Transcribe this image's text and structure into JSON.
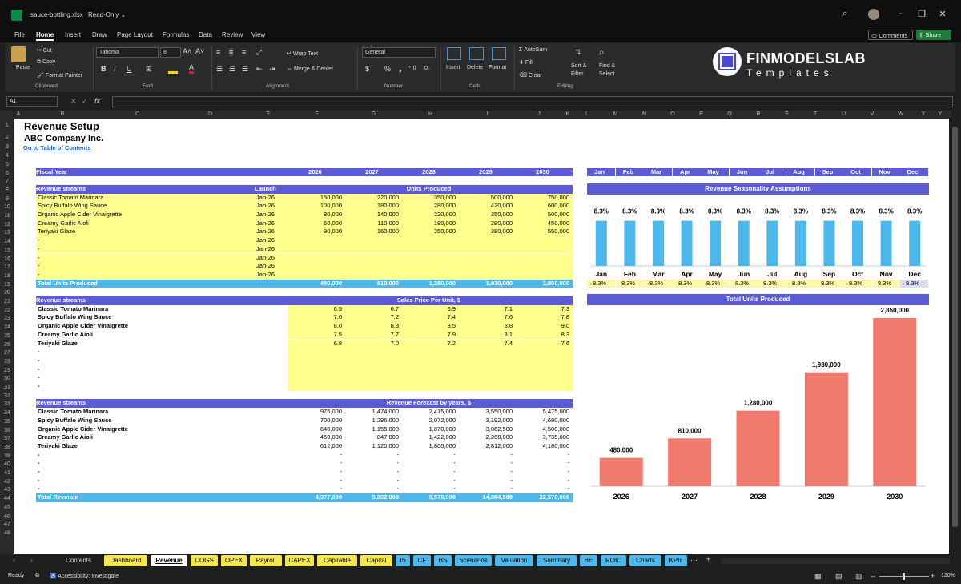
{
  "window": {
    "filename": "sauce-bottling.xlsx",
    "mode": "Read-Only ⌄"
  },
  "menu": [
    "File",
    "Home",
    "Insert",
    "Draw",
    "Page Layout",
    "Formulas",
    "Data",
    "Review",
    "View"
  ],
  "menu_right": {
    "comments": "Comments",
    "share": "Share"
  },
  "ribbon": {
    "clipboard": {
      "paste": "Paste",
      "cut": "Cut",
      "copy": "Copy",
      "format_painter": "Format Painter",
      "label": "Clipboard"
    },
    "font": {
      "name": "Tahoma",
      "size": "8",
      "label": "Font",
      "bold": "B",
      "italic": "I",
      "underline": "U"
    },
    "alignment": {
      "wrap": "Wrap Text",
      "merge": "Merge & Center",
      "label": "Alignment"
    },
    "number": {
      "format": "General",
      "label": "Number"
    },
    "cells": {
      "insert": "Insert",
      "delete": "Delete",
      "format": "Format",
      "label": "Cells"
    },
    "editing": {
      "autosum": "AutoSum",
      "fill": "Fill",
      "clear": "Clear",
      "sort": "Sort &",
      "sort2": "Filter",
      "find": "Find &",
      "find2": "Select",
      "label": "Editing"
    }
  },
  "brand": {
    "line1": "FINMODELSLAB",
    "line2": "Templates"
  },
  "namebox": "A1",
  "fx": "fx",
  "columns": [
    "A",
    "B",
    "C",
    "D",
    "E",
    "F",
    "G",
    "H",
    "I",
    "J",
    "K",
    "L",
    "M",
    "N",
    "O",
    "P",
    "Q",
    "R",
    "S",
    "T",
    "U",
    "V",
    "W",
    "X",
    "Y"
  ],
  "rows": [
    "1",
    "2",
    "3",
    "4",
    "5",
    "6",
    "7",
    "8",
    "9",
    "10",
    "11",
    "12",
    "13",
    "14",
    "15",
    "16",
    "17",
    "18",
    "19",
    "20",
    "21",
    "22",
    "23",
    "24",
    "25",
    "26",
    "27",
    "28",
    "29",
    "30",
    "31",
    "32",
    "33",
    "34",
    "35",
    "36",
    "37",
    "38",
    "39",
    "40",
    "41",
    "42",
    "43",
    "44",
    "45",
    "46",
    "47",
    "48"
  ],
  "sheet": {
    "title": "Revenue Setup",
    "company": "ABC Company Inc.",
    "toc_link": "Go to Table of Contents",
    "fiscal_year": "Fiscal Year",
    "years": [
      "2026",
      "2027",
      "2028",
      "2029",
      "2030"
    ],
    "months": [
      "Jan",
      "Feb",
      "Mar",
      "Apr",
      "May",
      "Jun",
      "Jul",
      "Aug",
      "Sep",
      "Oct",
      "Nov",
      "Dec"
    ],
    "revenue_streams": "Revenue streams",
    "launch": "Launch",
    "units_produced": "Units Produced",
    "units_rows": [
      {
        "name": "Classic Tomato Marinara",
        "launch": "Jan-26",
        "v": [
          "150,000",
          "220,000",
          "350,000",
          "500,000",
          "750,000"
        ]
      },
      {
        "name": "Spicy Buffalo Wing Sauce",
        "launch": "Jan-26",
        "v": [
          "100,000",
          "180,000",
          "280,000",
          "420,000",
          "600,000"
        ]
      },
      {
        "name": "Organic Apple Cider Vinaigrette",
        "launch": "Jan-26",
        "v": [
          "80,000",
          "140,000",
          "220,000",
          "350,000",
          "500,000"
        ]
      },
      {
        "name": "Creamy Garlic Aioli",
        "launch": "Jan-26",
        "v": [
          "60,000",
          "110,000",
          "180,000",
          "280,000",
          "450,000"
        ]
      },
      {
        "name": "Teriyaki Glaze",
        "launch": "Jan-26",
        "v": [
          "90,000",
          "160,000",
          "250,000",
          "380,000",
          "550,000"
        ]
      },
      {
        "name": "-",
        "launch": "Jan-26",
        "v": [
          "",
          "",
          "",
          "",
          ""
        ]
      },
      {
        "name": "-",
        "launch": "Jan-26",
        "v": [
          "",
          "",
          "",
          "",
          ""
        ]
      },
      {
        "name": "-",
        "launch": "Jan-26",
        "v": [
          "",
          "",
          "",
          "",
          ""
        ]
      },
      {
        "name": "-",
        "launch": "Jan-26",
        "v": [
          "",
          "",
          "",
          "",
          ""
        ]
      },
      {
        "name": "-",
        "launch": "Jan-26",
        "v": [
          "",
          "",
          "",
          "",
          ""
        ]
      }
    ],
    "total_units_label": "Total Units Produced",
    "total_units": [
      "480,000",
      "810,000",
      "1,280,000",
      "1,930,000",
      "2,850,000"
    ],
    "price_header": "Sales Price Per Unit, $",
    "price_rows": [
      {
        "name": "Classic Tomato Marinara",
        "v": [
          "6.5",
          "6.7",
          "6.9",
          "7.1",
          "7.3"
        ]
      },
      {
        "name": "Spicy Buffalo Wing Sauce",
        "v": [
          "7.0",
          "7.2",
          "7.4",
          "7.6",
          "7.8"
        ]
      },
      {
        "name": "Organic Apple Cider Vinaigrette",
        "v": [
          "8.0",
          "8.3",
          "8.5",
          "8.8",
          "9.0"
        ]
      },
      {
        "name": "Creamy Garlic Aioli",
        "v": [
          "7.5",
          "7.7",
          "7.9",
          "8.1",
          "8.3"
        ]
      },
      {
        "name": "Teriyaki Glaze",
        "v": [
          "6.8",
          "7.0",
          "7.2",
          "7.4",
          "7.6"
        ]
      },
      {
        "name": "-",
        "v": [
          "",
          "",
          "",
          "",
          ""
        ]
      },
      {
        "name": "-",
        "v": [
          "",
          "",
          "",
          "",
          ""
        ]
      },
      {
        "name": "-",
        "v": [
          "",
          "",
          "",
          "",
          ""
        ]
      },
      {
        "name": "-",
        "v": [
          "",
          "",
          "",
          "",
          ""
        ]
      },
      {
        "name": "-",
        "v": [
          "",
          "",
          "",
          "",
          ""
        ]
      }
    ],
    "revenue_header": "Revenue Forecast by years, $",
    "revenue_rows": [
      {
        "name": "Classic Tomato Marinara",
        "v": [
          "975,000",
          "1,474,000",
          "2,415,000",
          "3,550,000",
          "5,475,000"
        ]
      },
      {
        "name": "Spicy Buffalo Wing Sauce",
        "v": [
          "700,000",
          "1,296,000",
          "2,072,000",
          "3,192,000",
          "4,680,000"
        ]
      },
      {
        "name": "Organic Apple Cider Vinaigrette",
        "v": [
          "640,000",
          "1,155,000",
          "1,870,000",
          "3,062,500",
          "4,500,000"
        ]
      },
      {
        "name": "Creamy Garlic Aioli",
        "v": [
          "450,000",
          "847,000",
          "1,422,000",
          "2,268,000",
          "3,735,000"
        ]
      },
      {
        "name": "Teriyaki Glaze",
        "v": [
          "612,000",
          "1,120,000",
          "1,800,000",
          "2,812,000",
          "4,180,000"
        ]
      },
      {
        "name": "-",
        "v": [
          "-",
          "-",
          "-",
          "-",
          "-"
        ]
      },
      {
        "name": "-",
        "v": [
          "-",
          "-",
          "-",
          "-",
          "-"
        ]
      },
      {
        "name": "-",
        "v": [
          "-",
          "-",
          "-",
          "-",
          "-"
        ]
      },
      {
        "name": "-",
        "v": [
          "-",
          "-",
          "-",
          "-",
          "-"
        ]
      },
      {
        "name": "-",
        "v": [
          "-",
          "-",
          "-",
          "-",
          "-"
        ]
      }
    ],
    "total_revenue_label": "Total Revenue",
    "total_revenue": [
      "3,377,000",
      "5,892,000",
      "9,579,000",
      "14,884,500",
      "22,570,000"
    ],
    "seasonality_header": "Revenue Seasonality Assumptions",
    "seasonality": [
      "8.3%",
      "8.3%",
      "8.3%",
      "8.3%",
      "8.3%",
      "8.3%",
      "8.3%",
      "8.3%",
      "8.3%",
      "8.3%",
      "8.3%",
      "8.3%"
    ],
    "units_chart_header": "Total Units Produced"
  },
  "chart_data": [
    {
      "type": "bar",
      "title": "Revenue Seasonality Assumptions",
      "categories": [
        "Jan",
        "Feb",
        "Mar",
        "Apr",
        "May",
        "Jun",
        "Jul",
        "Aug",
        "Sep",
        "Oct",
        "Nov",
        "Dec"
      ],
      "values": [
        8.3,
        8.3,
        8.3,
        8.3,
        8.3,
        8.3,
        8.3,
        8.3,
        8.3,
        8.3,
        8.3,
        8.3
      ],
      "data_labels": [
        "8.3%",
        "8.3%",
        "8.3%",
        "8.3%",
        "8.3%",
        "8.3%",
        "8.3%",
        "8.3%",
        "8.3%",
        "8.3%",
        "8.3%",
        "8.3%"
      ],
      "color": "#4db8ec"
    },
    {
      "type": "bar",
      "title": "Total Units Produced",
      "categories": [
        "2026",
        "2027",
        "2028",
        "2029",
        "2030"
      ],
      "values": [
        480000,
        810000,
        1280000,
        1930000,
        2850000
      ],
      "data_labels": [
        "480,000",
        "810,000",
        "1,280,000",
        "1,930,000",
        "2,850,000"
      ],
      "color": "#f07a6e"
    }
  ],
  "tabs": [
    {
      "label": "Contents",
      "color": "#1f1f1f",
      "text": "#ddd"
    },
    {
      "label": "Dashboard",
      "color": "#f2e84b",
      "text": "#000"
    },
    {
      "label": "Revenue",
      "color": "#ffffff",
      "text": "#000",
      "active": true
    },
    {
      "label": "COGS",
      "color": "#f2e84b",
      "text": "#000"
    },
    {
      "label": "OPEX",
      "color": "#f2e84b",
      "text": "#000"
    },
    {
      "label": "Payroll",
      "color": "#f2e84b",
      "text": "#000"
    },
    {
      "label": "CAPEX",
      "color": "#f2e84b",
      "text": "#000"
    },
    {
      "label": "CapTable",
      "color": "#f2e84b",
      "text": "#000"
    },
    {
      "label": "Capital",
      "color": "#f2e84b",
      "text": "#000"
    },
    {
      "label": "IS",
      "color": "#4db8ec",
      "text": "#000"
    },
    {
      "label": "CF",
      "color": "#4db8ec",
      "text": "#000"
    },
    {
      "label": "BS",
      "color": "#4db8ec",
      "text": "#000"
    },
    {
      "label": "Scenarios",
      "color": "#4db8ec",
      "text": "#000"
    },
    {
      "label": "Valuation",
      "color": "#4db8ec",
      "text": "#000"
    },
    {
      "label": "Summary",
      "color": "#4db8ec",
      "text": "#000"
    },
    {
      "label": "BE",
      "color": "#4db8ec",
      "text": "#000"
    },
    {
      "label": "ROIC",
      "color": "#4db8ec",
      "text": "#000"
    },
    {
      "label": "Charts",
      "color": "#4db8ec",
      "text": "#000"
    },
    {
      "label": "KPIs",
      "color": "#4db8ec",
      "text": "#000"
    }
  ],
  "status": {
    "ready": "Ready",
    "accessibility": "Accessibility: Investigate",
    "zoom": "120%"
  }
}
